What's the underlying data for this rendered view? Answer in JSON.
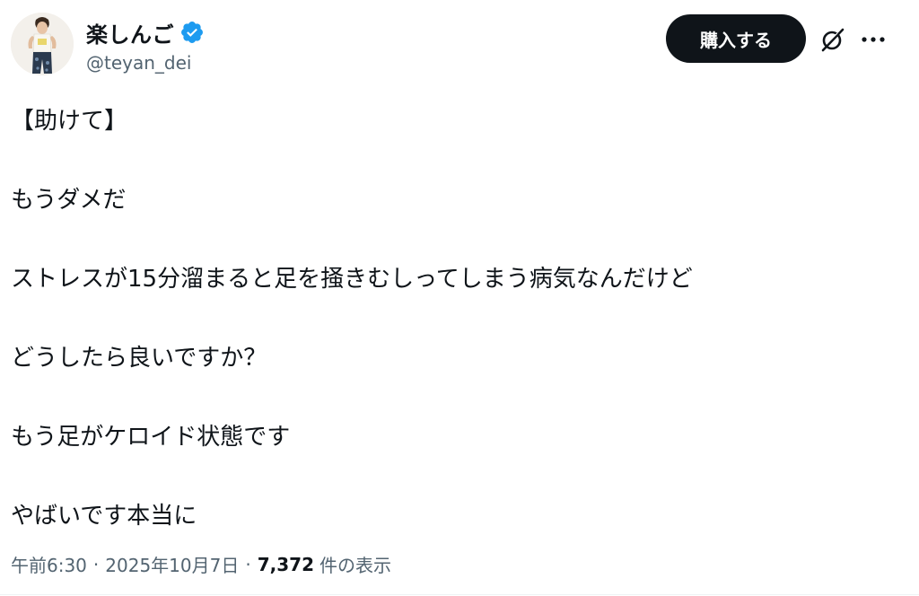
{
  "author": {
    "display_name": "楽しんご",
    "handle": "@teyan_dei",
    "verified_icon": "verified-badge-icon",
    "verified_color": "#1d9bf0"
  },
  "header": {
    "buy_button_label": "購入する",
    "grok_icon": "grok-icon",
    "more_icon": "more-dots-icon"
  },
  "post": {
    "lines": [
      "【助けて】",
      "もうダメだ",
      "ストレスが15分溜まると足を掻きむしってしまう病気なんだけど",
      "どうしたら良いですか？",
      "もう足がケロイド状態です",
      "やばいです本当に"
    ]
  },
  "meta": {
    "time": "午前6:30",
    "separator": "·",
    "date": "2025年10月7日",
    "views_count": "7,372",
    "views_label": "件の表示"
  },
  "colors": {
    "text": "#0f1419",
    "secondary": "#536471",
    "button_bg": "#0f1419"
  }
}
